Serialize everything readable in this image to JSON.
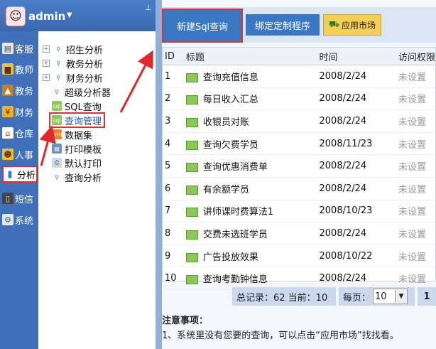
{
  "user": {
    "name": "admin"
  },
  "nav": [
    {
      "label": "客服",
      "icon": "document-icon",
      "color": "#e8e8e8"
    },
    {
      "label": "教师",
      "icon": "book-icon",
      "color": "#f0c040"
    },
    {
      "label": "教务",
      "icon": "cap-icon",
      "color": "#c08030"
    },
    {
      "label": "财务",
      "icon": "money-icon",
      "color": "#f0b020"
    },
    {
      "label": "仓库",
      "icon": "house-icon",
      "color": "#e04020"
    },
    {
      "label": "人事",
      "icon": "person-icon",
      "color": "#f0c020"
    },
    {
      "label": "分析",
      "icon": "bar-chart-icon",
      "color": "#3080e0"
    },
    {
      "label": "短信",
      "icon": "phone-icon",
      "color": "#444444"
    },
    {
      "label": "系统",
      "icon": "system-icon",
      "color": "#e8e8e8"
    }
  ],
  "tree": [
    {
      "label": "招生分析",
      "expand": "+",
      "icon": "search-icon"
    },
    {
      "label": "教务分析",
      "expand": "+",
      "icon": "search-icon"
    },
    {
      "label": "财务分析",
      "expand": "+",
      "icon": "search-icon"
    },
    {
      "label": "超级分析器",
      "expand": "",
      "icon": "search-icon"
    },
    {
      "label": "SQL查询",
      "expand": "",
      "icon": "sql-icon"
    },
    {
      "label": "查询管理",
      "expand": "",
      "icon": "sql-icon"
    },
    {
      "label": "数据集",
      "expand": "",
      "icon": "xml-icon"
    },
    {
      "label": "打印模板",
      "expand": "",
      "icon": "print-template-icon"
    },
    {
      "label": "默认打印",
      "expand": "",
      "icon": "printer-icon"
    },
    {
      "label": "查询分析",
      "expand": "",
      "icon": "search-icon"
    }
  ],
  "toolbar": {
    "new_sql": "新建Sql查询",
    "bind_program": "绑定定制程序",
    "app_market": "应用市场"
  },
  "table": {
    "headers": {
      "id": "ID",
      "title": "标题",
      "time": "时间",
      "perm": "访问权限"
    },
    "rows": [
      {
        "id": "1",
        "title": "查询充值信息",
        "time": "2008/2/24",
        "perm": "未设置"
      },
      {
        "id": "2",
        "title": "每日收入汇总",
        "time": "2008/2/24",
        "perm": "未设置"
      },
      {
        "id": "3",
        "title": "收银员对账",
        "time": "2008/2/24",
        "perm": "未设置"
      },
      {
        "id": "4",
        "title": "查询欠费学员",
        "time": "2008/11/23",
        "perm": "未设置"
      },
      {
        "id": "5",
        "title": "查询优惠消费单",
        "time": "2008/2/24",
        "perm": "未设置"
      },
      {
        "id": "6",
        "title": "有余额学员",
        "time": "2008/2/24",
        "perm": "未设置"
      },
      {
        "id": "7",
        "title": "讲师课时费算法1",
        "time": "2008/10/23",
        "perm": "未设置"
      },
      {
        "id": "8",
        "title": "交费未选班学员",
        "time": "2008/2/24",
        "perm": "未设置"
      },
      {
        "id": "9",
        "title": "广告投放效果",
        "time": "2008/10/22",
        "perm": "未设置"
      },
      {
        "id": "10",
        "title": "查询考勤钟信息",
        "time": "2008/2/24",
        "perm": "未设置"
      }
    ]
  },
  "pager": {
    "summary": "总记录：62 当前：10",
    "per_page_label": "每页：",
    "per_page_value": "10",
    "page": "1"
  },
  "notes": {
    "heading": "注意事项：",
    "line1": "1、系统里没有您要的查询，可以点击“应用市场”找找看。"
  }
}
